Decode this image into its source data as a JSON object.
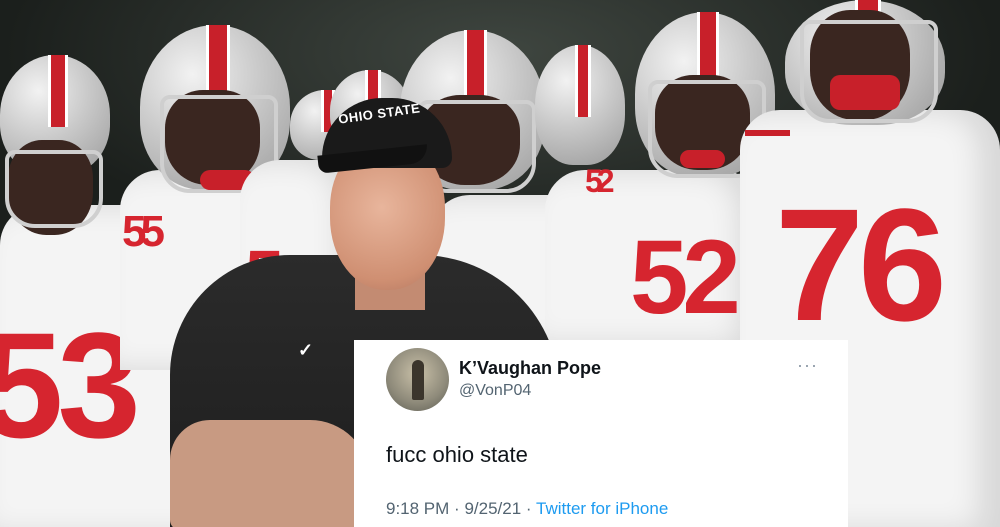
{
  "background": {
    "jersey_numbers": [
      "53",
      "55",
      "5",
      "52",
      "52",
      "76"
    ],
    "cap_text": "OHIO STATE"
  },
  "tweet": {
    "display_name": "K’Vaughan Pope",
    "handle": "@VonP04",
    "more_label": "···",
    "text": "fucc ohio state",
    "time": "9:18 PM",
    "separator": "·",
    "date": "9/25/21",
    "source": "Twitter for iPhone"
  },
  "colors": {
    "jersey_red": "#d6252f",
    "link_blue": "#1d9bf0",
    "secondary_text": "#536471"
  }
}
